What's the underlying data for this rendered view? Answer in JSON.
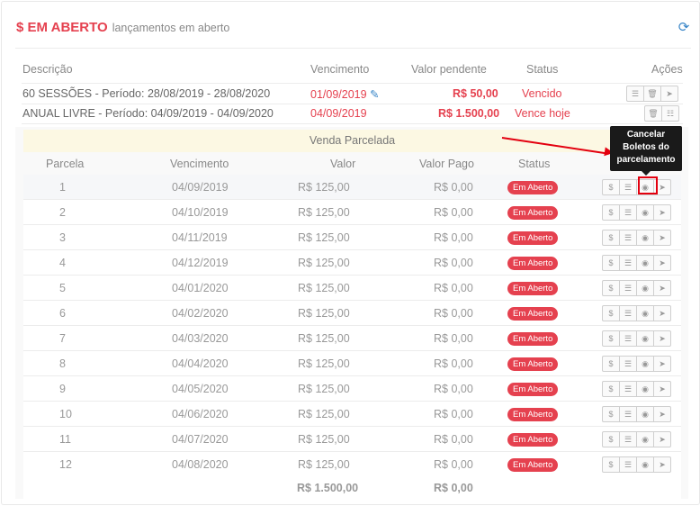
{
  "header": {
    "title": "$ EM ABERTO",
    "subtitle": "lançamentos em aberto",
    "refresh_icon": "refresh-icon"
  },
  "main_table": {
    "columns": [
      "Descrição",
      "Vencimento",
      "Valor pendente",
      "Status",
      "Ações"
    ],
    "rows": [
      {
        "descricao": "60 SESSÕES - Período: 28/08/2019 - 28/08/2020",
        "vencimento": "01/09/2019",
        "valor": "R$ 50,00",
        "status": "Vencido",
        "icons": [
          "list-icon",
          "trash-icon",
          "send-icon"
        ]
      },
      {
        "descricao": "ANUAL LIVRE - Período: 04/09/2019 - 04/09/2020",
        "vencimento": "04/09/2019",
        "valor": "R$ 1.500,00",
        "status": "Vence hoje",
        "icons": [
          "trash-icon",
          "sliders-icon"
        ]
      }
    ]
  },
  "installments": {
    "banner": "Venda Parcelada",
    "columns": [
      "Parcela",
      "Vencimento",
      "Valor",
      "Valor Pago",
      "Status"
    ],
    "badge": "Em Aberto",
    "rows": [
      {
        "n": "1",
        "venc": "04/09/2019",
        "valor": "R$ 125,00",
        "pago": "R$ 0,00"
      },
      {
        "n": "2",
        "venc": "04/10/2019",
        "valor": "R$ 125,00",
        "pago": "R$ 0,00"
      },
      {
        "n": "3",
        "venc": "04/11/2019",
        "valor": "R$ 125,00",
        "pago": "R$ 0,00"
      },
      {
        "n": "4",
        "venc": "04/12/2019",
        "valor": "R$ 125,00",
        "pago": "R$ 0,00"
      },
      {
        "n": "5",
        "venc": "04/01/2020",
        "valor": "R$ 125,00",
        "pago": "R$ 0,00"
      },
      {
        "n": "6",
        "venc": "04/02/2020",
        "valor": "R$ 125,00",
        "pago": "R$ 0,00"
      },
      {
        "n": "7",
        "venc": "04/03/2020",
        "valor": "R$ 125,00",
        "pago": "R$ 0,00"
      },
      {
        "n": "8",
        "venc": "04/04/2020",
        "valor": "R$ 125,00",
        "pago": "R$ 0,00"
      },
      {
        "n": "9",
        "venc": "04/05/2020",
        "valor": "R$ 125,00",
        "pago": "R$ 0,00"
      },
      {
        "n": "10",
        "venc": "04/06/2020",
        "valor": "R$ 125,00",
        "pago": "R$ 0,00"
      },
      {
        "n": "11",
        "venc": "04/07/2020",
        "valor": "R$ 125,00",
        "pago": "R$ 0,00"
      },
      {
        "n": "12",
        "venc": "04/08/2020",
        "valor": "R$ 125,00",
        "pago": "R$ 0,00"
      }
    ],
    "totals": {
      "valor": "R$ 1.500,00",
      "pago": "R$ 0,00"
    },
    "row_icons": [
      "dollar-icon",
      "list-icon",
      "cancel-circle-icon",
      "send-icon"
    ]
  },
  "tooltip": {
    "line1": "Cancelar",
    "line2": "Boletos do",
    "line3": "parcelamento"
  },
  "colors": {
    "accent_red": "#e5414f",
    "annotation_red": "#e3000f",
    "banner_bg": "#fcf8e3",
    "tooltip_bg": "#1a1a1a"
  }
}
